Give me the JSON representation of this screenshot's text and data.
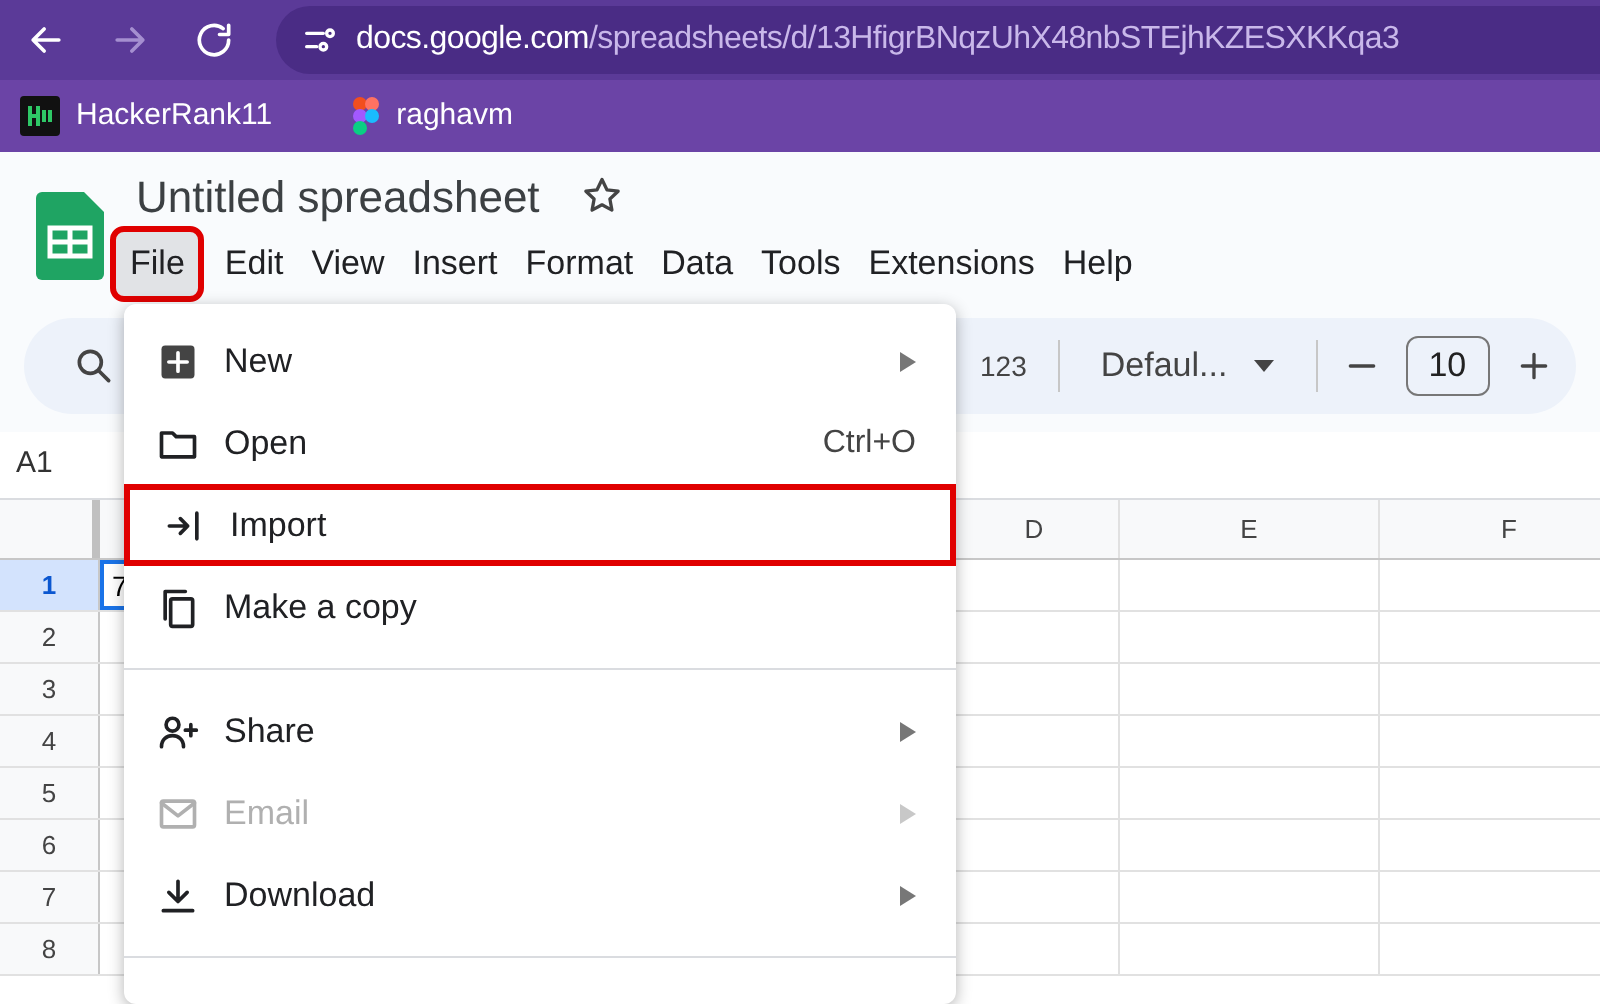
{
  "browser": {
    "url_domain": "docs.google.com",
    "url_path": "/spreadsheets/d/13HfigrBNqzUhX48nbSTEjhKZESXKKqa3"
  },
  "bookmarks": [
    {
      "label": "HackerRank11",
      "kind": "hackerrank"
    },
    {
      "label": "raghavm",
      "kind": "figma"
    }
  ],
  "document": {
    "title": "Untitled spreadsheet",
    "starred": false
  },
  "menu_bar": [
    {
      "label": "File",
      "selected": true,
      "highlighted": true
    },
    {
      "label": "Edit",
      "selected": false,
      "highlighted": false
    },
    {
      "label": "View",
      "selected": false,
      "highlighted": false
    },
    {
      "label": "Insert",
      "selected": false,
      "highlighted": false
    },
    {
      "label": "Format",
      "selected": false,
      "highlighted": false
    },
    {
      "label": "Data",
      "selected": false,
      "highlighted": false
    },
    {
      "label": "Tools",
      "selected": false,
      "highlighted": false
    },
    {
      "label": "Extensions",
      "selected": false,
      "highlighted": false
    },
    {
      "label": "Help",
      "selected": false,
      "highlighted": false
    }
  ],
  "toolbar": {
    "number_format": "123",
    "font": "Defaul...",
    "font_size": "10"
  },
  "name_box": "A1",
  "grid": {
    "columns": [
      "D",
      "E",
      "F"
    ],
    "rows": [
      "1",
      "2",
      "3",
      "4",
      "5",
      "6",
      "7",
      "8"
    ],
    "cell_a1": "7"
  },
  "file_menu": [
    {
      "label": "New",
      "kind": "new",
      "submenu": true,
      "disabled": false,
      "highlighted": false,
      "divider_after": false
    },
    {
      "label": "Open",
      "kind": "open",
      "shortcut": "Ctrl+O",
      "submenu": false,
      "disabled": false,
      "highlighted": false,
      "divider_after": false
    },
    {
      "label": "Import",
      "kind": "import",
      "submenu": false,
      "disabled": false,
      "highlighted": true,
      "divider_after": false
    },
    {
      "label": "Make a copy",
      "kind": "copy",
      "submenu": false,
      "disabled": false,
      "highlighted": false,
      "divider_after": true
    },
    {
      "label": "Share",
      "kind": "share",
      "submenu": true,
      "disabled": false,
      "highlighted": false,
      "divider_after": false
    },
    {
      "label": "Email",
      "kind": "email",
      "submenu": true,
      "disabled": true,
      "highlighted": false,
      "divider_after": false
    },
    {
      "label": "Download",
      "kind": "download",
      "submenu": true,
      "disabled": false,
      "highlighted": false,
      "divider_after": true
    }
  ]
}
